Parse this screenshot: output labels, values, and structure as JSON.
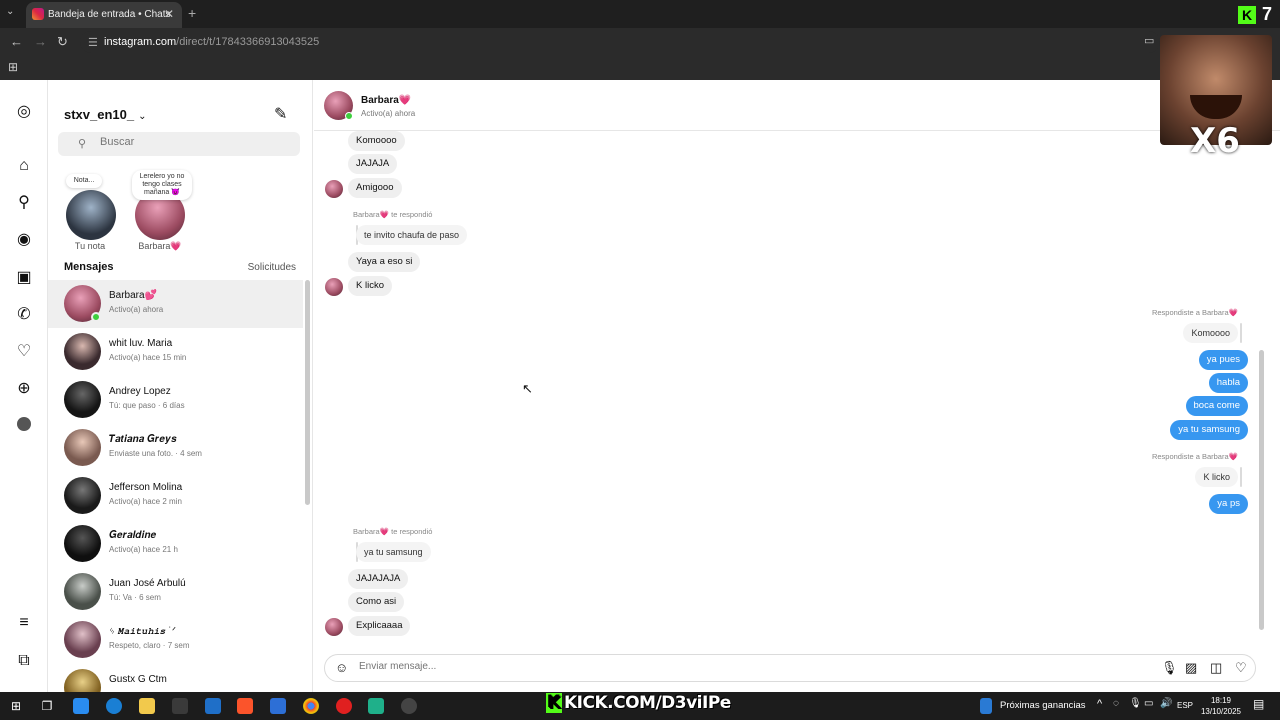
{
  "browser": {
    "tab_title": "Bandeja de entrada • Chats",
    "url_host": "instagram.com",
    "url_path": "/direct/t/17843366913043525"
  },
  "sidebar": {
    "username": "stxv_en10_",
    "search_placeholder": "Buscar",
    "notes": [
      {
        "bubble": "Nota...",
        "label": "Tu nota"
      },
      {
        "bubble": "Lerelero yo no tengo clases mañana 😈",
        "label": "Barbara💗"
      }
    ],
    "messages_header": "Mensajes",
    "requests_label": "Solicitudes",
    "conversations": [
      {
        "name": "Barbara💕",
        "sub": "Activo(a) ahora",
        "active": true,
        "online": true
      },
      {
        "name": "whit luv. Maria",
        "sub": "Activo(a) hace 15 min"
      },
      {
        "name": "Andrey Lopez",
        "sub": "Tú: que paso · 6 días"
      },
      {
        "name": "𝑻𝒂𝒕𝒊𝒂𝒏𝒂 𝑮𝒓𝒆𝒚𝒔",
        "sub": "Enviaste una foto. · 4 sem"
      },
      {
        "name": "Jefferson Molina",
        "sub": "Activo(a) hace 2 min"
      },
      {
        "name": "𝑮𝒆𝒓𝒂𝒍𝒅𝒊𝒏𝒆",
        "sub": "Activo(a) hace 21 h"
      },
      {
        "name": "Juan José Arbulú",
        "sub": "Tú: Va · 6 sem"
      },
      {
        "name": "ᛃ 𝑴𝒂𝒊𝒕𝒖𝒉𝒊𝒔 ˙ᐟ",
        "sub": "Respeto, claro · 7 sem"
      },
      {
        "name": "Gustx G Ctm",
        "sub": ""
      }
    ]
  },
  "chat": {
    "name": "Barbara💗",
    "status": "Activo(a) ahora",
    "messages": {
      "m1": "Komoooo",
      "m2": "JAJAJA",
      "m3": "Amigooo",
      "reply1_label": "Barbara💗 te respondió",
      "reply1_quote": "te invito chaufa de paso",
      "m4": "Yaya a eso si",
      "m5": "K licko",
      "out_reply1_label": "Respondiste a Barbara💗",
      "out_reply1_quote": "Komoooo",
      "o1": "ya pues",
      "o2": "habla",
      "o3": "boca come",
      "o4": "ya tu samsung",
      "out_reply2_label": "Respondiste a Barbara💗",
      "out_reply2_quote": "K licko",
      "o5": "ya ps",
      "reply2_label": "Barbara💗 te respondió",
      "reply2_quote": "ya tu samsung",
      "m6": "JAJAJAJA",
      "m7": "Como asi",
      "m8": "Explicaaaa"
    },
    "composer_placeholder": "Enviar mensaje..."
  },
  "overlay": {
    "multiplier": "X6",
    "counter": "7"
  },
  "taskbar": {
    "kick_text": "KICK.COM/D3viIPe",
    "weather": "Próximas ganancias",
    "lang": "ESP",
    "time": "18:19",
    "date": "13/10/2025"
  }
}
